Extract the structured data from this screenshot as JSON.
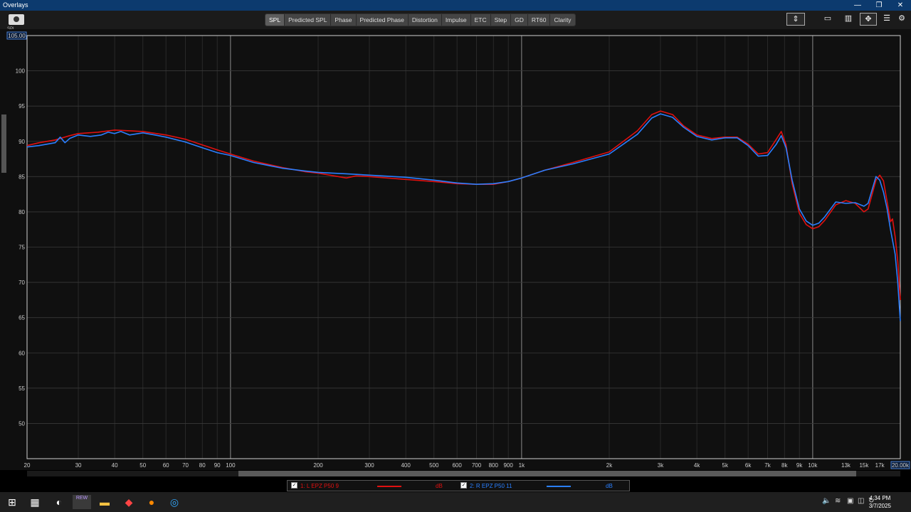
{
  "window": {
    "title": "Overlays",
    "controls": [
      "—",
      "❐",
      "✕"
    ]
  },
  "toolbar": {
    "camera_icon": "camera-icon",
    "y_unit": "SPL",
    "tabs": [
      "SPL",
      "Predicted SPL",
      "Phase",
      "Predicted Phase",
      "Distortion",
      "Impulse",
      "ETC",
      "Step",
      "GD",
      "RT60",
      "Clarity"
    ],
    "active_tab": "SPL"
  },
  "chart_data": {
    "type": "line",
    "x_scale": "log",
    "xlim": [
      20,
      20000
    ],
    "ylim": [
      45,
      105
    ],
    "y_top_readout": "105.00",
    "x_right_readout": "20.00k",
    "grid": true,
    "y_ticks": [
      50,
      55,
      60,
      65,
      70,
      75,
      80,
      85,
      90,
      95,
      100
    ],
    "x_ticks": [
      {
        "v": 20,
        "label": "20"
      },
      {
        "v": 30,
        "label": "30"
      },
      {
        "v": 40,
        "label": "40"
      },
      {
        "v": 50,
        "label": "50"
      },
      {
        "v": 60,
        "label": "60"
      },
      {
        "v": 70,
        "label": "70"
      },
      {
        "v": 80,
        "label": "80"
      },
      {
        "v": 90,
        "label": "90"
      },
      {
        "v": 100,
        "label": "100"
      },
      {
        "v": 200,
        "label": "200"
      },
      {
        "v": 300,
        "label": "300"
      },
      {
        "v": 400,
        "label": "400"
      },
      {
        "v": 500,
        "label": "500"
      },
      {
        "v": 600,
        "label": "600"
      },
      {
        "v": 700,
        "label": "700"
      },
      {
        "v": 800,
        "label": "800"
      },
      {
        "v": 900,
        "label": "900"
      },
      {
        "v": 1000,
        "label": "1k"
      },
      {
        "v": 2000,
        "label": "2k"
      },
      {
        "v": 3000,
        "label": "3k"
      },
      {
        "v": 4000,
        "label": "4k"
      },
      {
        "v": 5000,
        "label": "5k"
      },
      {
        "v": 6000,
        "label": "6k"
      },
      {
        "v": 7000,
        "label": "7k"
      },
      {
        "v": 8000,
        "label": "8k"
      },
      {
        "v": 9000,
        "label": "9k"
      },
      {
        "v": 10000,
        "label": "10k"
      },
      {
        "v": 13000,
        "label": "13k"
      },
      {
        "v": 15000,
        "label": "15k"
      },
      {
        "v": 17000,
        "label": "17k"
      }
    ],
    "series": [
      {
        "name": "1: L EPZ P50 9",
        "color": "#e01010",
        "points": [
          [
            20,
            89.4
          ],
          [
            22,
            89.8
          ],
          [
            25,
            90.2
          ],
          [
            28,
            90.8
          ],
          [
            30,
            91.1
          ],
          [
            35,
            91.3
          ],
          [
            40,
            91.6
          ],
          [
            45,
            91.5
          ],
          [
            50,
            91.4
          ],
          [
            60,
            90.9
          ],
          [
            70,
            90.3
          ],
          [
            80,
            89.5
          ],
          [
            90,
            88.8
          ],
          [
            100,
            88.2
          ],
          [
            120,
            87.2
          ],
          [
            150,
            86.3
          ],
          [
            180,
            85.7
          ],
          [
            200,
            85.5
          ],
          [
            250,
            84.8
          ],
          [
            270,
            85.1
          ],
          [
            300,
            85.0
          ],
          [
            400,
            84.6
          ],
          [
            500,
            84.3
          ],
          [
            600,
            84.0
          ],
          [
            700,
            83.9
          ],
          [
            800,
            83.9
          ],
          [
            900,
            84.3
          ],
          [
            1000,
            84.8
          ],
          [
            1200,
            85.9
          ],
          [
            1500,
            87.0
          ],
          [
            2000,
            88.5
          ],
          [
            2500,
            91.5
          ],
          [
            2800,
            93.8
          ],
          [
            3000,
            94.3
          ],
          [
            3300,
            93.8
          ],
          [
            3600,
            92.2
          ],
          [
            4000,
            90.9
          ],
          [
            4500,
            90.4
          ],
          [
            5000,
            90.6
          ],
          [
            5500,
            90.6
          ],
          [
            6000,
            89.6
          ],
          [
            6500,
            88.2
          ],
          [
            7000,
            88.4
          ],
          [
            7500,
            90.3
          ],
          [
            7800,
            91.4
          ],
          [
            8100,
            89.5
          ],
          [
            8500,
            84.0
          ],
          [
            9000,
            79.8
          ],
          [
            9500,
            78.2
          ],
          [
            10000,
            77.6
          ],
          [
            10500,
            77.9
          ],
          [
            11000,
            78.8
          ],
          [
            12000,
            81.0
          ],
          [
            13000,
            81.6
          ],
          [
            14000,
            81.2
          ],
          [
            15000,
            80.0
          ],
          [
            15500,
            80.4
          ],
          [
            16500,
            84.5
          ],
          [
            17000,
            85.2
          ],
          [
            17500,
            84.4
          ],
          [
            18000,
            81.5
          ],
          [
            18500,
            78.6
          ],
          [
            18800,
            79.0
          ],
          [
            19200,
            76.5
          ],
          [
            19600,
            73.0
          ],
          [
            20000,
            67.5
          ]
        ]
      },
      {
        "name": "2: R EPZ P50 11",
        "color": "#2a7fff",
        "points": [
          [
            20,
            89.2
          ],
          [
            22,
            89.4
          ],
          [
            25,
            89.8
          ],
          [
            26,
            90.6
          ],
          [
            27,
            89.8
          ],
          [
            28,
            90.4
          ],
          [
            30,
            90.9
          ],
          [
            33,
            90.7
          ],
          [
            36,
            90.9
          ],
          [
            38,
            91.3
          ],
          [
            40,
            91.1
          ],
          [
            42,
            91.4
          ],
          [
            45,
            90.9
          ],
          [
            50,
            91.2
          ],
          [
            55,
            90.9
          ],
          [
            60,
            90.6
          ],
          [
            70,
            89.9
          ],
          [
            80,
            89.1
          ],
          [
            90,
            88.4
          ],
          [
            100,
            88.0
          ],
          [
            120,
            87.0
          ],
          [
            150,
            86.2
          ],
          [
            180,
            85.8
          ],
          [
            200,
            85.6
          ],
          [
            250,
            85.4
          ],
          [
            300,
            85.2
          ],
          [
            400,
            84.9
          ],
          [
            500,
            84.5
          ],
          [
            600,
            84.1
          ],
          [
            700,
            83.9
          ],
          [
            800,
            84.0
          ],
          [
            900,
            84.3
          ],
          [
            1000,
            84.8
          ],
          [
            1200,
            85.9
          ],
          [
            1500,
            86.8
          ],
          [
            2000,
            88.2
          ],
          [
            2500,
            91.0
          ],
          [
            2800,
            93.3
          ],
          [
            3000,
            93.9
          ],
          [
            3300,
            93.4
          ],
          [
            3600,
            92.0
          ],
          [
            4000,
            90.7
          ],
          [
            4500,
            90.2
          ],
          [
            5000,
            90.5
          ],
          [
            5500,
            90.5
          ],
          [
            6000,
            89.4
          ],
          [
            6500,
            87.9
          ],
          [
            7000,
            88.0
          ],
          [
            7500,
            89.6
          ],
          [
            7800,
            90.8
          ],
          [
            8100,
            89.1
          ],
          [
            8500,
            84.5
          ],
          [
            9000,
            80.4
          ],
          [
            9500,
            78.7
          ],
          [
            10000,
            78.1
          ],
          [
            10500,
            78.4
          ],
          [
            11000,
            79.3
          ],
          [
            12000,
            81.4
          ],
          [
            13000,
            81.2
          ],
          [
            14000,
            81.3
          ],
          [
            15000,
            80.8
          ],
          [
            15500,
            81.2
          ],
          [
            16500,
            85.0
          ],
          [
            17000,
            84.5
          ],
          [
            17500,
            82.8
          ],
          [
            18000,
            80.5
          ],
          [
            18500,
            77.5
          ],
          [
            19200,
            74.0
          ],
          [
            19600,
            70.0
          ],
          [
            20000,
            64.5
          ]
        ]
      }
    ]
  },
  "legend": [
    {
      "checked": true,
      "label": "1: L EPZ P50 9",
      "unit": "dB",
      "color": "#e01010"
    },
    {
      "checked": true,
      "label": "2: R EPZ P50 11",
      "unit": "dB",
      "color": "#2a7fff"
    }
  ],
  "taskbar": {
    "apps": [
      "windows-start-icon",
      "calculator-icon",
      "app-icon",
      "rew-app-icon",
      "file-explorer-icon",
      "app-red-icon",
      "firefox-icon",
      "edge-icon"
    ],
    "rew_label": "REW",
    "time": "4:34 PM",
    "date": "3/7/2025"
  }
}
